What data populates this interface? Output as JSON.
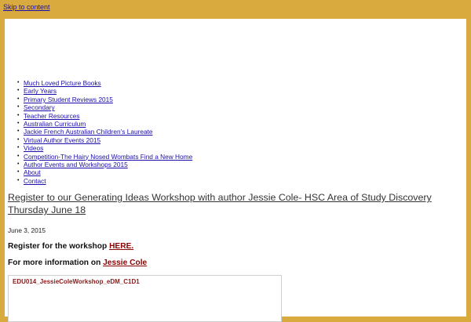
{
  "skip_link": "Skip to content",
  "nav": {
    "items": [
      "Much Loved Picture Books",
      "Early Years",
      "Primary Student Reviews 2015",
      "Secondary",
      "Teacher Resources",
      "Australian Curriculum",
      "Jackie French Australian Children’s Laureate",
      "Virtual Author Events 2015",
      "Videos",
      "Competition-The Hairy Nosed Wombats Find a New Home",
      "Author Events and Workshops 2015",
      "About",
      "Contact"
    ]
  },
  "post": {
    "title": "Register to our Generating Ideas Workshop with author Jessie Cole- HSC Area of Study Discovery Thursday June 18",
    "date": "June 3, 2015",
    "para1_text": "Register for the workshop ",
    "para1_link": "HERE.",
    "para2_text": "For more information on ",
    "para2_link": "Jessie Cole",
    "embed_title": "EDU014_JessieColeWorkshop_eDM_C1D1"
  },
  "colors": {
    "page_background": "#d9aa3d",
    "content_background": "#ffffff",
    "nav_link": "#1a0dab",
    "post_link": "#8b0000"
  }
}
